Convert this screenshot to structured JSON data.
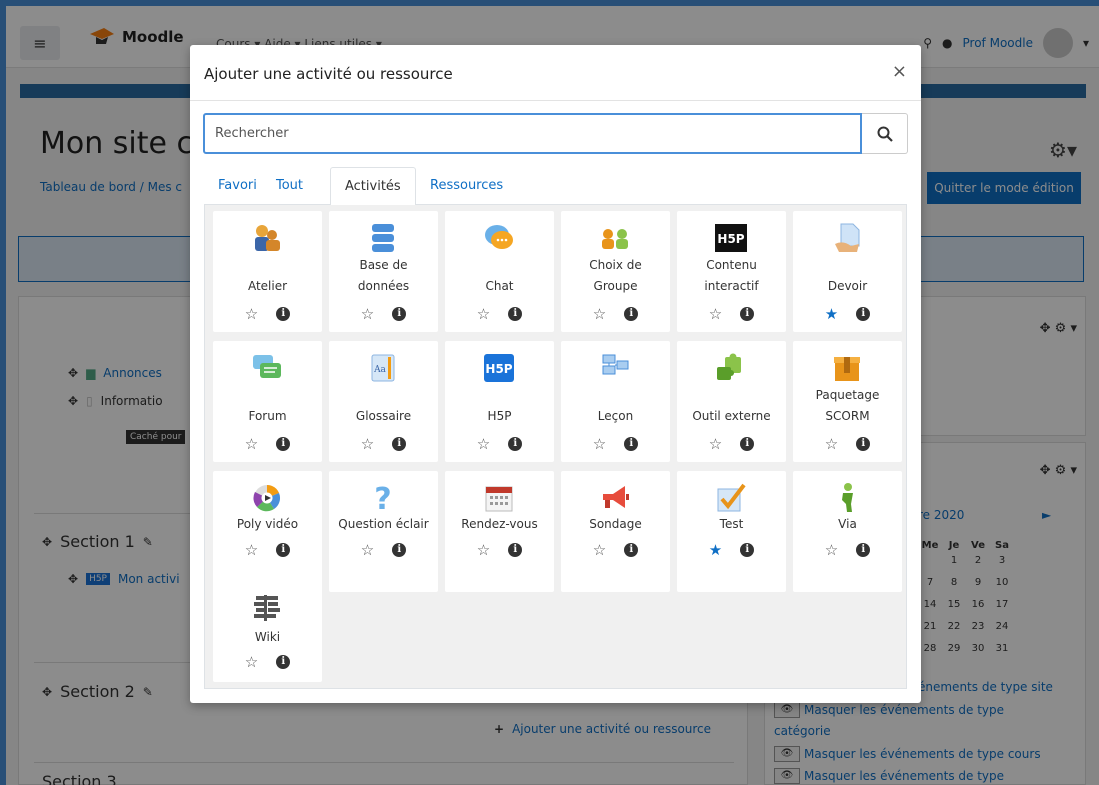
{
  "navbar": {
    "brand": "Moodle",
    "links": "Cours ▾   Aide ▾   Liens utiles ▾",
    "user": "Prof Moodle"
  },
  "page": {
    "title": "Mon site c",
    "breadcrumb": "Tableau de bord  /  Mes c",
    "quit_edit": "Quitter le mode édition",
    "announces": "Annonces",
    "informations": "Informatio",
    "hidden_badge": "Caché pour",
    "section1": "Section 1",
    "my_activity": "Mon activi",
    "section2": "Section 2",
    "add_activity": "Ajouter une activité ou ressource",
    "section3": "Section 3"
  },
  "calendar": {
    "month": "re 2020",
    "days": [
      "Me",
      "Je",
      "Ve",
      "Sa"
    ],
    "weeks": [
      [
        "",
        "1",
        "2",
        "3"
      ],
      [
        "7",
        "8",
        "9",
        "10"
      ],
      [
        "14",
        "15",
        "16",
        "17"
      ],
      [
        "21",
        "22",
        "23",
        "24"
      ],
      [
        "28",
        "29",
        "30",
        "31"
      ]
    ],
    "events": [
      "énements de type site",
      "Masquer les événements de type",
      "catégorie",
      "Masquer les événements de type cours",
      "Masquer les événements de type"
    ]
  },
  "modal": {
    "title": "Ajouter une activité ou ressource",
    "search_placeholder": "Rechercher",
    "tabs": [
      "Favori",
      "Tout",
      "Activités",
      "Ressources"
    ],
    "active_tab": "Activités",
    "items": [
      {
        "label1": "",
        "label2": "Atelier",
        "icon": "workshop-icon",
        "favorite": false
      },
      {
        "label1": "Base de",
        "label2": "données",
        "icon": "database-icon",
        "favorite": false
      },
      {
        "label1": "",
        "label2": "Chat",
        "icon": "chat-icon",
        "favorite": false
      },
      {
        "label1": "Choix de",
        "label2": "Groupe",
        "icon": "group-choice-icon",
        "favorite": false
      },
      {
        "label1": "Contenu",
        "label2": "interactif",
        "icon": "h5p-black-icon",
        "favorite": false
      },
      {
        "label1": "",
        "label2": "Devoir",
        "icon": "assignment-icon",
        "favorite": true
      },
      {
        "label1": "",
        "label2": "Forum",
        "icon": "forum-icon",
        "favorite": false
      },
      {
        "label1": "",
        "label2": "Glossaire",
        "icon": "glossary-icon",
        "favorite": false
      },
      {
        "label1": "",
        "label2": "H5P",
        "icon": "h5p-icon",
        "favorite": false
      },
      {
        "label1": "",
        "label2": "Leçon",
        "icon": "lesson-icon",
        "favorite": false
      },
      {
        "label1": "",
        "label2": "Outil externe",
        "icon": "puzzle-icon",
        "favorite": false
      },
      {
        "label1": "Paquetage",
        "label2": "SCORM",
        "icon": "scorm-icon",
        "favorite": false
      },
      {
        "label1": "",
        "label2": "Poly vidéo",
        "icon": "video-icon",
        "favorite": false
      },
      {
        "label1": "",
        "label2": "Question éclair",
        "icon": "question-icon",
        "favorite": false
      },
      {
        "label1": "",
        "label2": "Rendez-vous",
        "icon": "calendar-icon",
        "favorite": false
      },
      {
        "label1": "",
        "label2": "Sondage",
        "icon": "megaphone-icon",
        "favorite": false
      },
      {
        "label1": "",
        "label2": "Test",
        "icon": "quiz-check-icon",
        "favorite": true
      },
      {
        "label1": "",
        "label2": "Via",
        "icon": "via-person-icon",
        "favorite": false
      },
      {
        "label1": "",
        "label2": "Wiki",
        "icon": "wiki-icon",
        "favorite": false
      }
    ]
  }
}
